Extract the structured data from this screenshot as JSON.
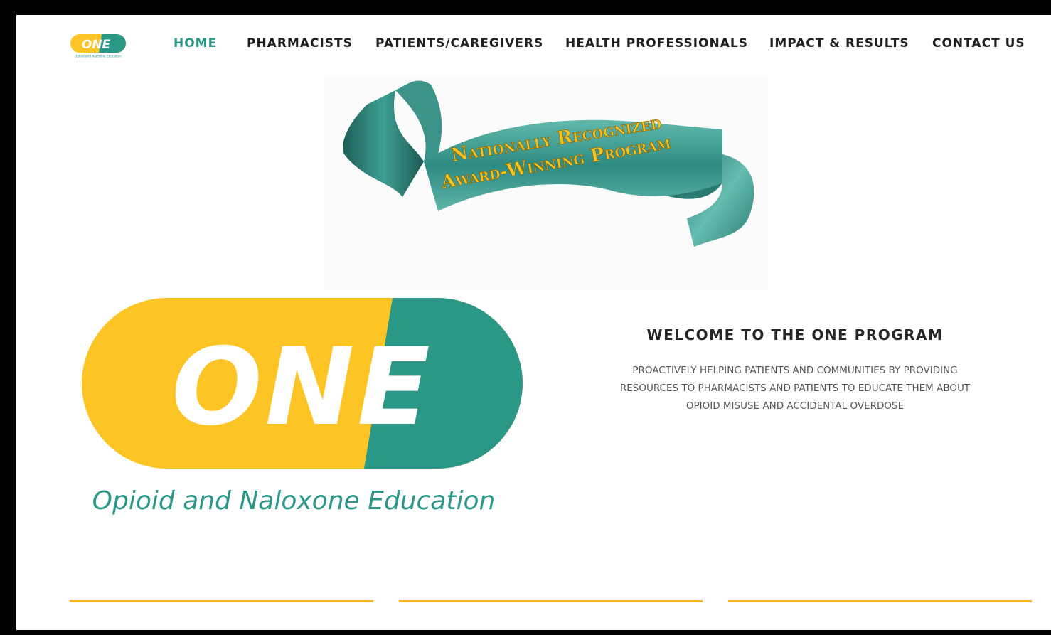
{
  "brand": {
    "logo_text": "ONE",
    "logo_subtitle": "Opioid and Naloxone Education",
    "colors": {
      "yellow": "#fdc425",
      "teal": "#2a9787",
      "divider": "#f2b71f"
    }
  },
  "nav": {
    "items": [
      {
        "label": "HOME",
        "active": true
      },
      {
        "label": "PHARMACISTS",
        "active": false
      },
      {
        "label": "PATIENTS/CAREGIVERS",
        "active": false
      },
      {
        "label": "HEALTH PROFESSIONALS",
        "active": false
      },
      {
        "label": "IMPACT & RESULTS",
        "active": false
      },
      {
        "label": "CONTACT US",
        "active": false
      }
    ]
  },
  "banner": {
    "line1": "Nationally Recognized",
    "line2": "Award-Winning Program"
  },
  "welcome": {
    "title": "WELCOME TO THE ONE PROGRAM",
    "text_line1": "PROACTIVELY HELPING PATIENTS AND COMMUNITIES BY PROVIDING",
    "text_line2": "RESOURCES TO PHARMACISTS AND PATIENTS TO EDUCATE THEM ABOUT",
    "text_line3": "OPIOID MISUSE AND ACCIDENTAL OVERDOSE"
  }
}
